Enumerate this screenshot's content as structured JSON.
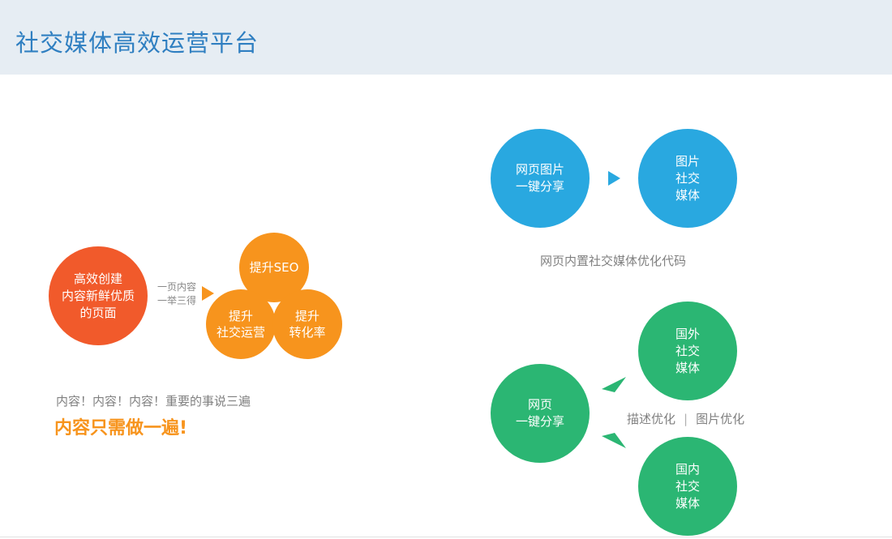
{
  "header": {
    "title": "社交媒体高效运营平台"
  },
  "left": {
    "create_circle": [
      "高效创建",
      "内容新鲜优质",
      "的页面"
    ],
    "arrow_label": [
      "一页内容",
      "一举三得"
    ],
    "seo_circle": [
      "提升SEO"
    ],
    "social_circle": [
      "提升",
      "社交运营"
    ],
    "conversion_circle": [
      "提升",
      "转化率"
    ],
    "repeat_text": "内容！内容！内容！重要的事说三遍",
    "once_text": "内容只需做一遍!"
  },
  "top_right": {
    "share_circle": [
      "网页图片",
      "一键分享"
    ],
    "target_circle": [
      "图片",
      "社交",
      "媒体"
    ],
    "caption": "网页内置社交媒体优化代码"
  },
  "bottom_right": {
    "share_circle": [
      "网页",
      "一键分享"
    ],
    "foreign_circle": [
      "国外",
      "社交",
      "媒体"
    ],
    "domestic_circle": [
      "国内",
      "社交",
      "媒体"
    ],
    "caption_left": "描述优化",
    "caption_sep": "|",
    "caption_right": "图片优化"
  },
  "colors": {
    "header_bg": "#e6edf3",
    "title": "#2f7fc1",
    "red": "#f15a2b",
    "orange": "#f7941d",
    "blue": "#29a8e0",
    "green": "#2bb673"
  }
}
